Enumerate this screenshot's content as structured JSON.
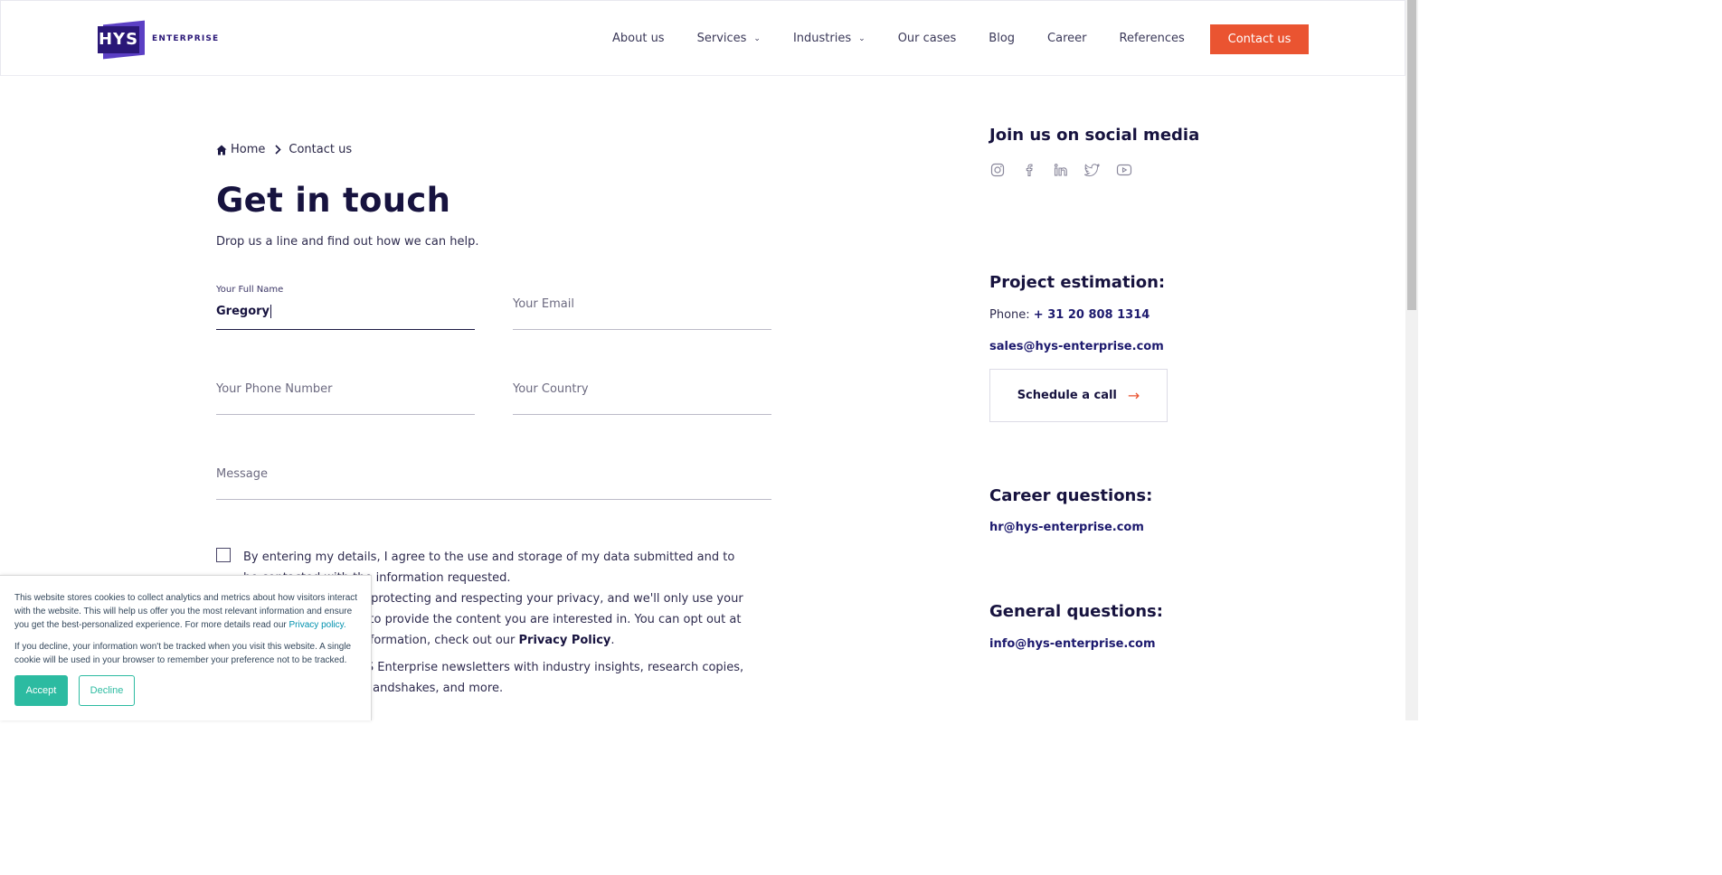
{
  "header": {
    "logo_mark": "HYS",
    "logo_text": "ENTERPRISE",
    "nav": [
      {
        "label": "About us",
        "dropdown": false
      },
      {
        "label": "Services",
        "dropdown": true
      },
      {
        "label": "Industries",
        "dropdown": true
      },
      {
        "label": "Our cases",
        "dropdown": false
      },
      {
        "label": "Blog",
        "dropdown": false
      },
      {
        "label": "Career",
        "dropdown": false
      },
      {
        "label": "References",
        "dropdown": false
      }
    ],
    "cta_label": "Contact us"
  },
  "breadcrumb": {
    "home": "Home",
    "current": "Contact us"
  },
  "main": {
    "title": "Get in touch",
    "subtitle": "Drop us a line and find out how we can help."
  },
  "form": {
    "full_name": {
      "label": "Your Full Name",
      "value": "Gregory"
    },
    "email": {
      "placeholder": "Your Email"
    },
    "phone": {
      "placeholder": "Your Phone Number"
    },
    "country": {
      "placeholder": "Your Country"
    },
    "message": {
      "placeholder": "Message"
    },
    "consent": {
      "line1": "By entering my details, I agree to the use and storage of my data submitted and to be contacted with the information requested.",
      "line2a": "We are committed to protecting and respecting your privacy, and we'll only use your personal information to provide the content you are interested in. You can opt out at any time. For more information, check out our ",
      "privacy_link": "Privacy Policy",
      "line2b": ".",
      "line3": "I agree to receive HYS Enterprise newsletters with industry insights, research copies, invitations to virtual handshakes, and more."
    }
  },
  "sidebar": {
    "social_title": "Join us on social media",
    "social_icons": [
      "instagram-icon",
      "facebook-icon",
      "linkedin-icon",
      "twitter-icon",
      "youtube-icon"
    ],
    "project_title": "Project estimation:",
    "phone_label": "Phone: ",
    "phone_value": "+ 31 20 808 1314",
    "sales_email": "sales@hys-enterprise.com",
    "schedule_label": "Schedule a call",
    "career_title": "Career questions:",
    "career_email": "hr@hys-enterprise.com",
    "general_title": "General questions:",
    "general_email": "info@hys-enterprise.com"
  },
  "cookie": {
    "text1": "This website stores cookies to collect analytics and metrics about how visitors interact with the website. This will help us offer you the most relevant information and ensure you get the best-personalized experience. For more details read our ",
    "privacy_link": "Privacy policy.",
    "text2": "If you decline, your information won't be tracked when you visit this website. A single cookie will be used in your browser to remember your preference not to be tracked.",
    "accept": "Accept",
    "decline": "Decline"
  },
  "colors": {
    "brand": "#2a1777",
    "accent": "#ea5431",
    "cookie_accent": "#2cbba1"
  }
}
